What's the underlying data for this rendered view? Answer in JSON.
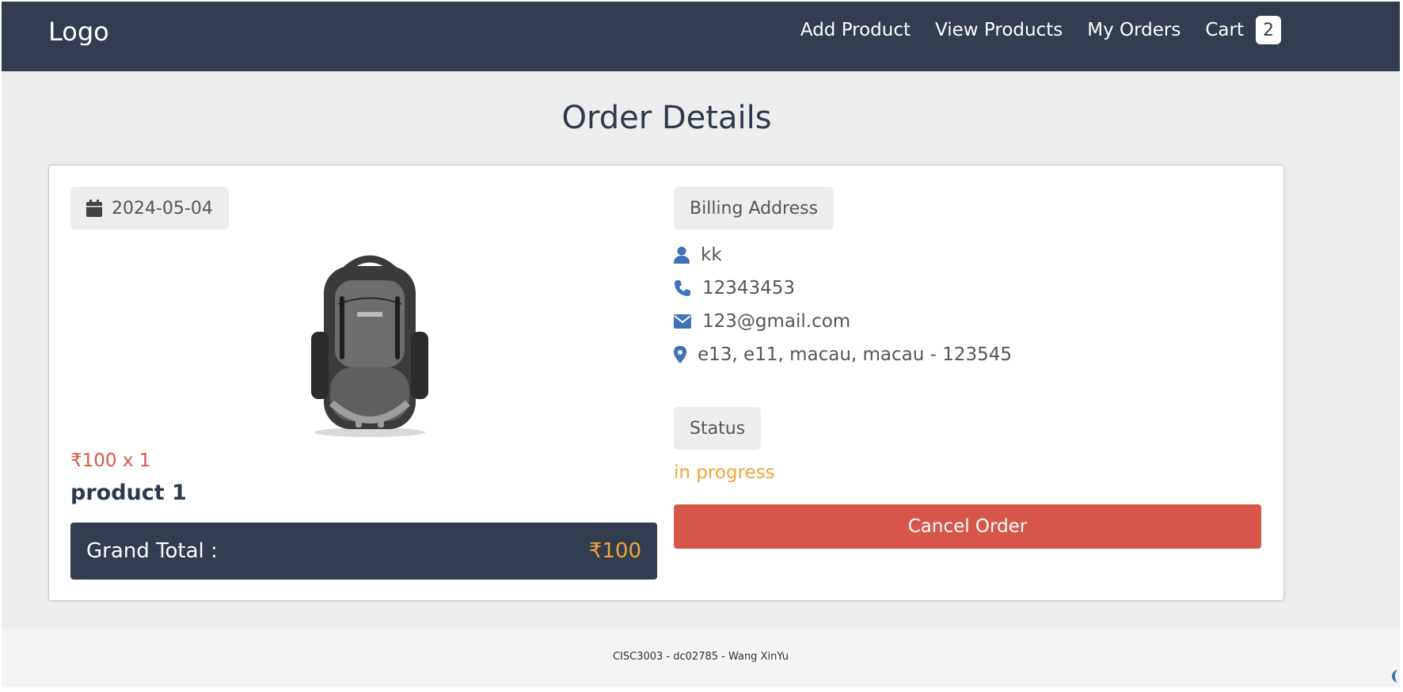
{
  "header": {
    "logo": "Logo",
    "nav": {
      "add_product": "Add Product",
      "view_products": "View Products",
      "my_orders": "My Orders",
      "cart": "Cart",
      "cart_count": "2"
    }
  },
  "page": {
    "title": "Order Details"
  },
  "order": {
    "date": "2024-05-04",
    "product": {
      "image_alt": "backpack",
      "price_line": "₹100 x 1",
      "name": "product 1"
    },
    "grand_total_label": "Grand Total :",
    "grand_total_value": "₹100"
  },
  "billing": {
    "heading": "Billing Address",
    "name": "kk",
    "phone": "12343453",
    "email": "123@gmail.com",
    "address": "e13, e11, macau, macau - 123545"
  },
  "status": {
    "heading": "Status",
    "value": "in progress"
  },
  "actions": {
    "cancel_label": "Cancel Order"
  },
  "footer": {
    "text": "CISC3003 - dc02785 - Wang XinYu"
  },
  "colors": {
    "header_bg": "#323e4f",
    "accent_red": "#d6574a",
    "accent_orange": "#f0a437",
    "icon_blue": "#3f72b4"
  },
  "icons": {
    "date": "calendar-icon",
    "name": "user-icon",
    "phone": "phone-icon",
    "email": "envelope-icon",
    "address": "map-marker-icon"
  }
}
